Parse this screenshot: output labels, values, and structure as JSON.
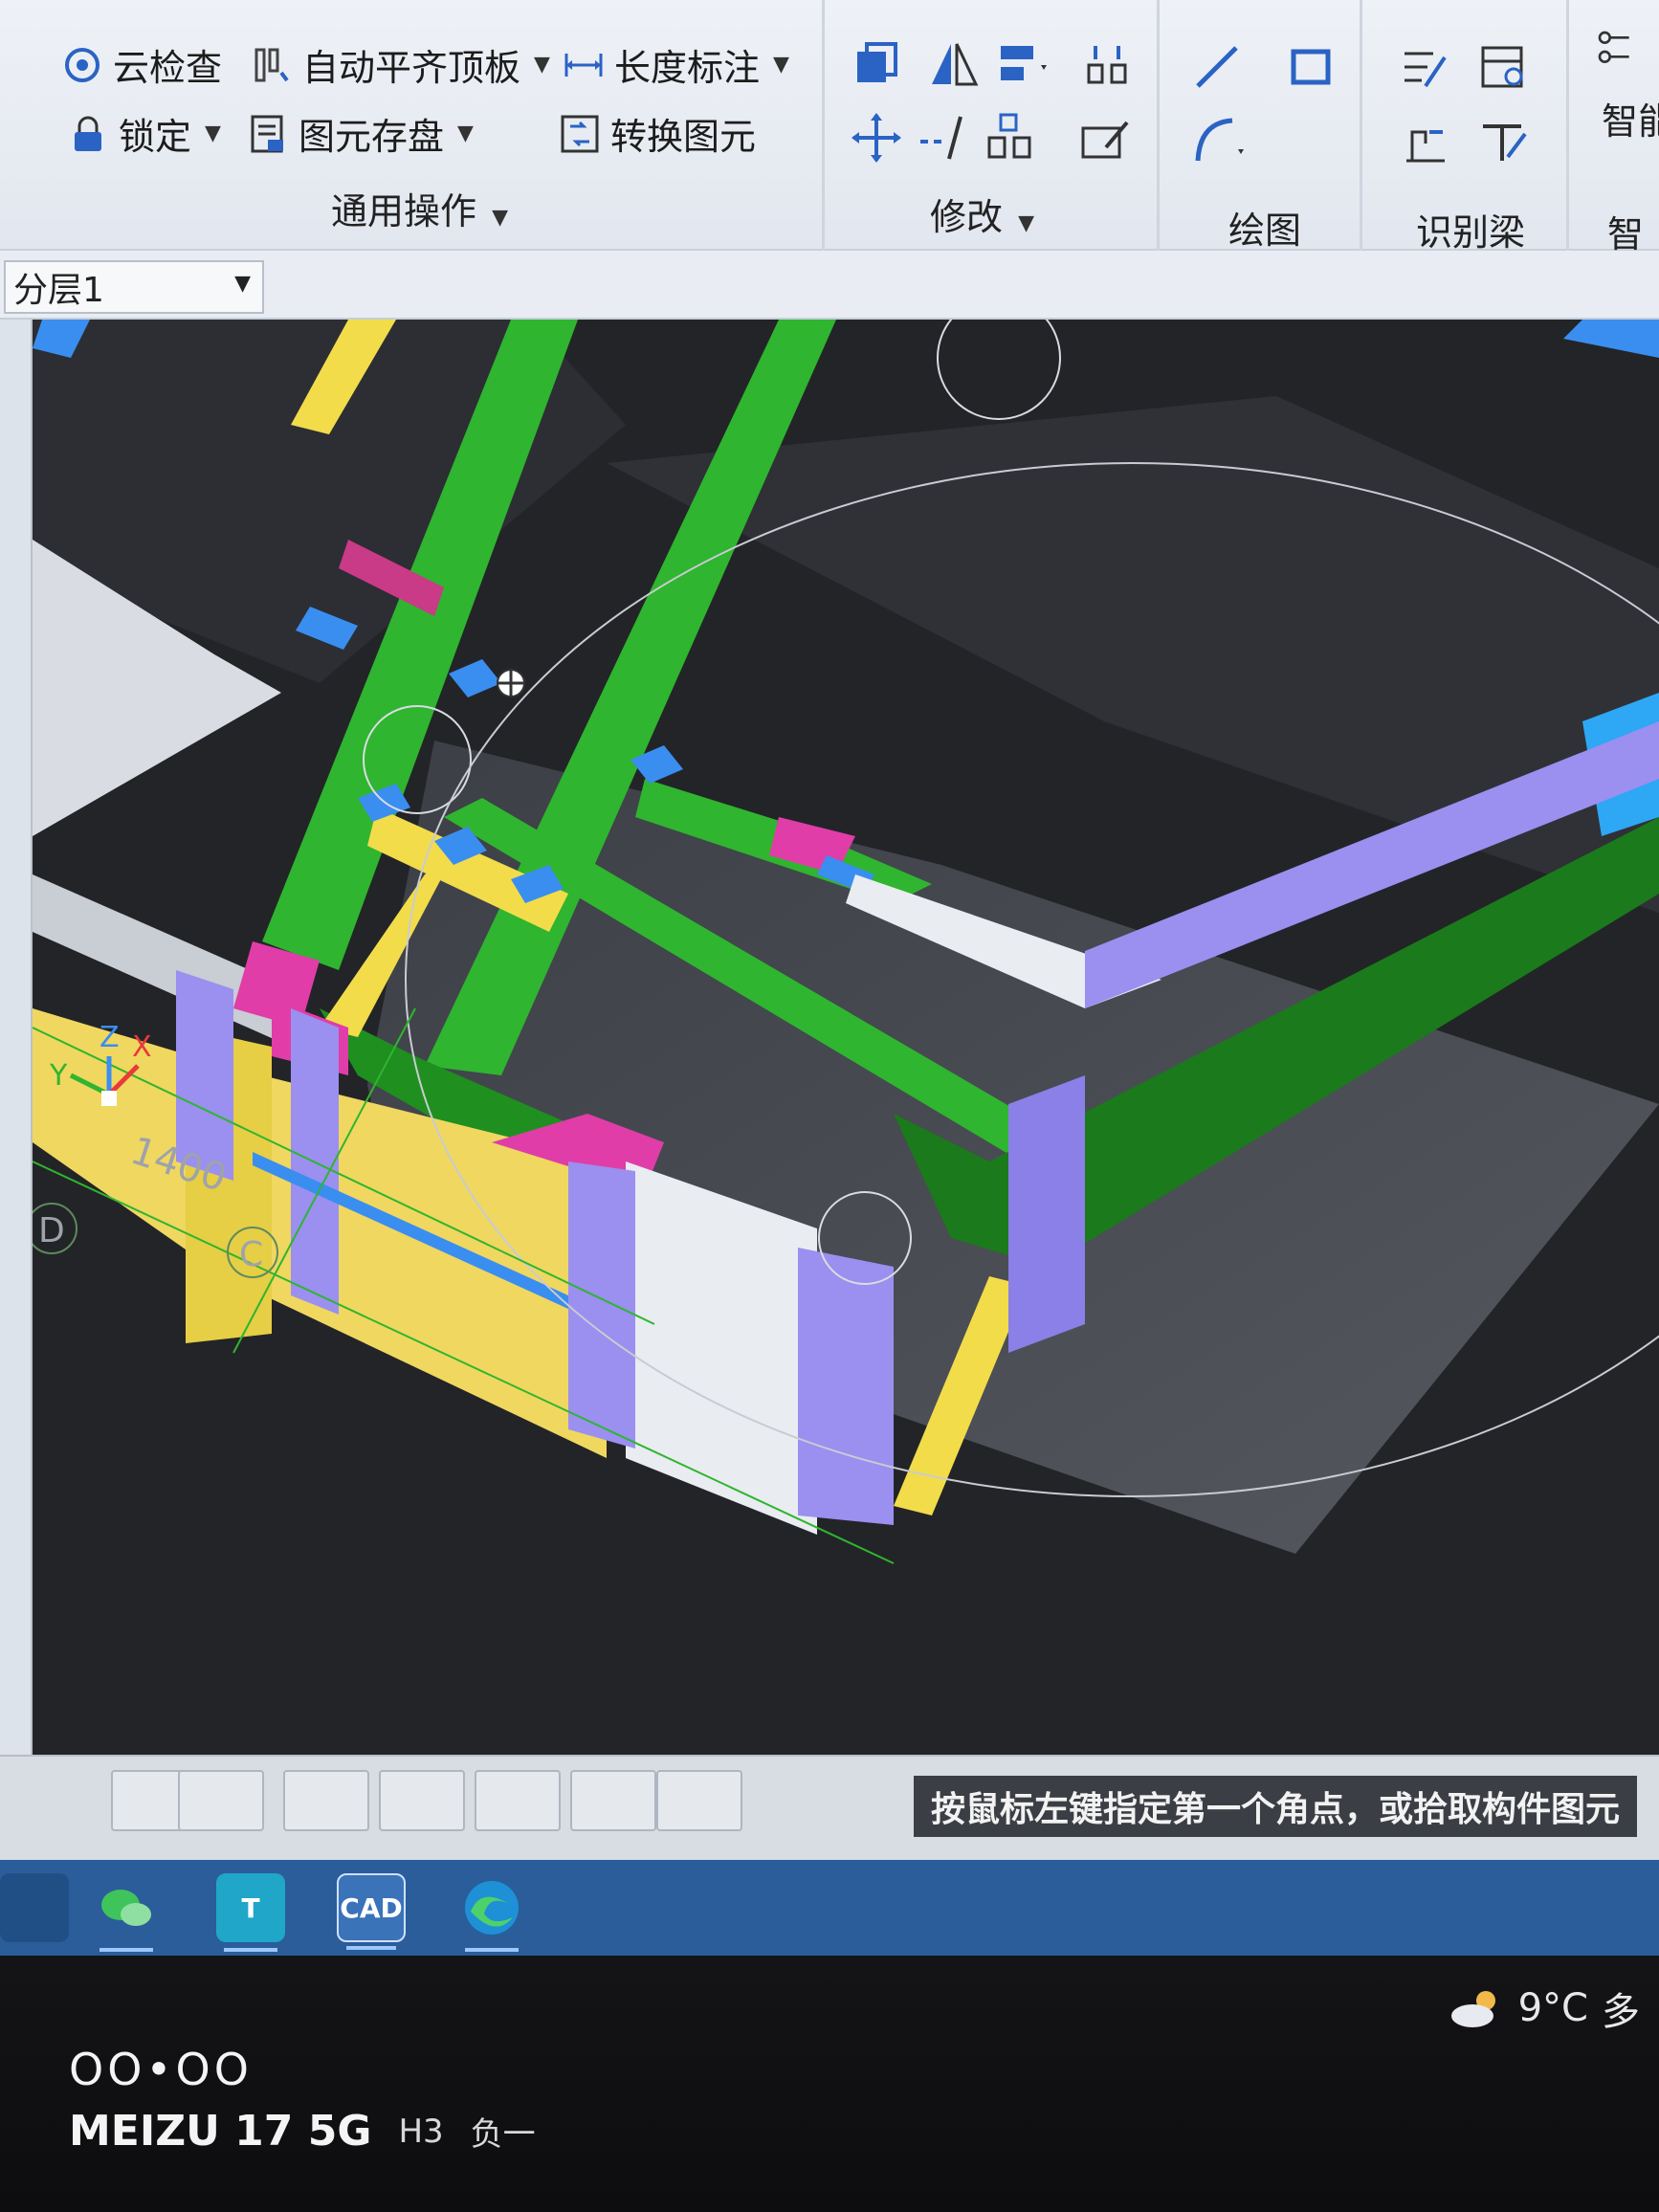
{
  "ribbon": {
    "general_ops": {
      "cloud_check": "云检查",
      "auto_align_slab": "自动平齐顶板",
      "length_dim": "长度标注",
      "lock": "锁定",
      "element_save": "图元存盘",
      "convert_element": "转换图元",
      "title": "通用操作"
    },
    "modify": {
      "title": "修改"
    },
    "draw": {
      "title": "绘图"
    },
    "recognize_beam": {
      "title": "识别梁"
    },
    "smart": {
      "title_1": "智能",
      "title_2": "智"
    }
  },
  "layer": {
    "selected": "分层1"
  },
  "viewport": {
    "axis_labels": {
      "x": "X",
      "y": "Y",
      "z": "Z"
    },
    "grid_labels": {
      "d": "D",
      "c": "C"
    },
    "dimension": "1400"
  },
  "status": {
    "prompt": "按鼠标左键指定第一个角点，或拾取构件图元"
  },
  "taskbar": {
    "apps": [
      {
        "name": "wechat",
        "label": ""
      },
      {
        "name": "t-app",
        "label": "T"
      },
      {
        "name": "cad-app",
        "label": "CAD"
      },
      {
        "name": "edge",
        "label": ""
      }
    ],
    "weather": {
      "temp": "9°C",
      "extra": "多"
    }
  },
  "phone_watermark": {
    "dots": "OO•OO",
    "model": "MEIZU 17 5G",
    "h": "H3",
    "neg": "负一"
  },
  "colors": {
    "beam_green": "#2fb52f",
    "beam_yellow": "#f2dc4a",
    "column_purple": "#9b8ff0",
    "joint_blue": "#3a8ef0",
    "beam_pink": "#e03da8",
    "slab_gray": "#4c4f56",
    "wall_white": "#e9ecf1"
  }
}
